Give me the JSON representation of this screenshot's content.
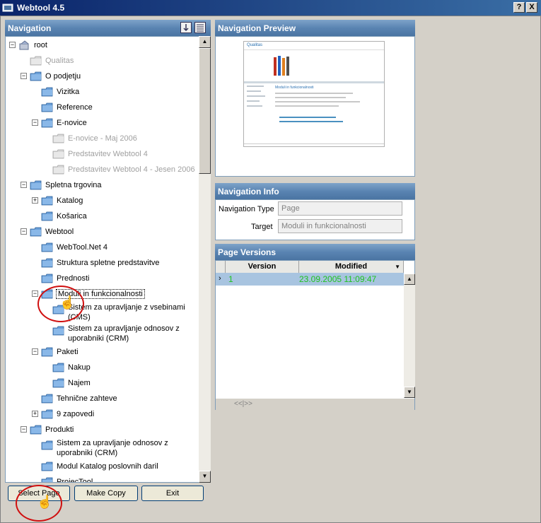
{
  "window": {
    "title": "Webtool 4.5",
    "help_label": "?",
    "close_label": "X"
  },
  "navigation": {
    "header": "Navigation",
    "tree": [
      {
        "label": "root",
        "level": 0,
        "expander": "−",
        "disabled": false,
        "icon": "root-icon"
      },
      {
        "label": "Qualitas",
        "level": 1,
        "expander": "",
        "disabled": true,
        "icon": "folder-icon"
      },
      {
        "label": "O podjetju",
        "level": 1,
        "expander": "−",
        "disabled": false,
        "icon": "folder-icon"
      },
      {
        "label": "Vizitka",
        "level": 2,
        "expander": "",
        "disabled": false,
        "icon": "folder-icon"
      },
      {
        "label": "Reference",
        "level": 2,
        "expander": "",
        "disabled": false,
        "icon": "folder-icon"
      },
      {
        "label": "E-novice",
        "level": 2,
        "expander": "−",
        "disabled": false,
        "icon": "folder-icon"
      },
      {
        "label": "E-novice - Maj 2006",
        "level": 3,
        "expander": "",
        "disabled": true,
        "icon": "folder-icon"
      },
      {
        "label": "Predstavitev Webtool 4",
        "level": 3,
        "expander": "",
        "disabled": true,
        "icon": "folder-icon"
      },
      {
        "label": "Predstavitev Webtool 4 - Jesen 2006",
        "level": 3,
        "expander": "",
        "disabled": true,
        "icon": "folder-icon"
      },
      {
        "label": "Spletna trgovina",
        "level": 1,
        "expander": "−",
        "disabled": false,
        "icon": "folder-icon"
      },
      {
        "label": "Katalog",
        "level": 2,
        "expander": "+",
        "disabled": false,
        "icon": "folder-icon"
      },
      {
        "label": "Košarica",
        "level": 2,
        "expander": "",
        "disabled": false,
        "icon": "folder-icon"
      },
      {
        "label": "Webtool",
        "level": 1,
        "expander": "−",
        "disabled": false,
        "icon": "folder-icon"
      },
      {
        "label": "WebTool.Net 4",
        "level": 2,
        "expander": "",
        "disabled": false,
        "icon": "folder-icon"
      },
      {
        "label": "Struktura spletne predstavitve",
        "level": 2,
        "expander": "",
        "disabled": false,
        "icon": "folder-icon"
      },
      {
        "label": "Prednosti",
        "level": 2,
        "expander": "",
        "disabled": false,
        "icon": "folder-icon"
      },
      {
        "label": "Moduli in funkcionalnosti",
        "level": 2,
        "expander": "−",
        "disabled": false,
        "icon": "folder-icon",
        "selected": true
      },
      {
        "label": "Sistem za upravljanje z vsebinami (CMS)",
        "level": 3,
        "expander": "",
        "disabled": false,
        "icon": "folder-icon",
        "wrap": true
      },
      {
        "label": "Sistem za upravljanje odnosov z uporabniki (CRM)",
        "level": 3,
        "expander": "",
        "disabled": false,
        "icon": "folder-icon",
        "wrap": true
      },
      {
        "label": "Paketi",
        "level": 2,
        "expander": "−",
        "disabled": false,
        "icon": "folder-icon"
      },
      {
        "label": "Nakup",
        "level": 3,
        "expander": "",
        "disabled": false,
        "icon": "folder-icon"
      },
      {
        "label": "Najem",
        "level": 3,
        "expander": "",
        "disabled": false,
        "icon": "folder-icon"
      },
      {
        "label": "Tehnične zahteve",
        "level": 2,
        "expander": "",
        "disabled": false,
        "icon": "folder-icon"
      },
      {
        "label": "9 zapovedi",
        "level": 2,
        "expander": "+",
        "disabled": false,
        "icon": "folder-icon"
      },
      {
        "label": "Produkti",
        "level": 1,
        "expander": "−",
        "disabled": false,
        "icon": "folder-icon"
      },
      {
        "label": "Sistem za upravljanje odnosov z uporabniki (CRM)",
        "level": 2,
        "expander": "",
        "disabled": false,
        "icon": "folder-icon",
        "wrap": true
      },
      {
        "label": "Modul Katalog poslovnih daril",
        "level": 2,
        "expander": "",
        "disabled": false,
        "icon": "folder-icon"
      },
      {
        "label": "ProjecTool",
        "level": 2,
        "expander": "",
        "disabled": false,
        "icon": "folder-icon"
      }
    ]
  },
  "buttons": {
    "select": "Select Page",
    "copy": "Make Copy",
    "exit": "Exit"
  },
  "preview": {
    "header": "Navigation Preview",
    "thumb_site": "Qualitas",
    "thumb_heading": "Moduli in funkcionalnosti"
  },
  "info": {
    "header": "Navigation Info",
    "type_label": "Navigation Type",
    "type_value": "Page",
    "target_label": "Target",
    "target_value": "Moduli in funkcionalnosti"
  },
  "versions": {
    "header": "Page Versions",
    "col_version": "Version",
    "col_modified": "Modified",
    "rows": [
      {
        "version": "1",
        "modified": "23.09.2005 11:09:47"
      }
    ],
    "pager": "<<|>>"
  },
  "colors": {
    "header_blue": "#5a84b2",
    "version_green": "#1ec21e",
    "highlight_circle": "#d01010"
  }
}
